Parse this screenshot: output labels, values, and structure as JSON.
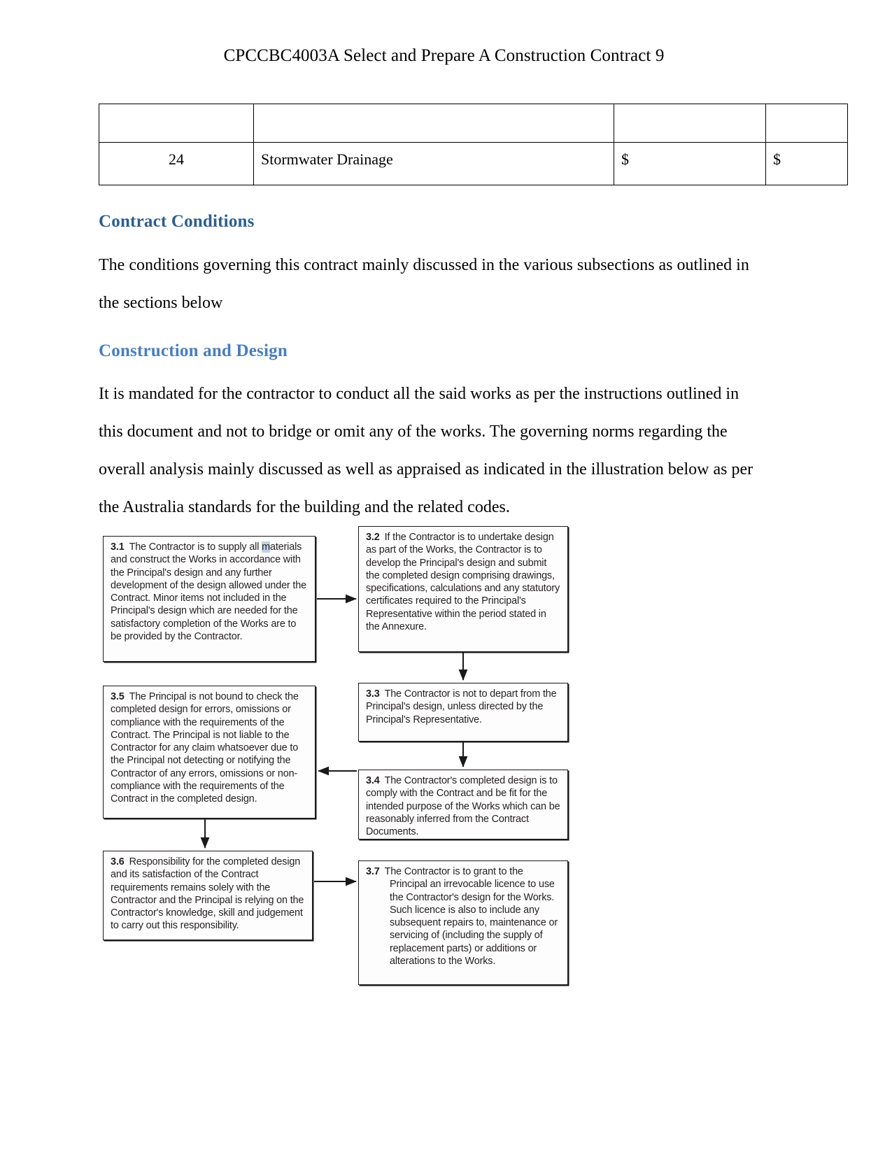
{
  "header": {
    "running_title": "CPCCBC4003A Select and Prepare A Construction Contract 9"
  },
  "table": {
    "rows": [
      {
        "no": "",
        "description": "",
        "rate": "",
        "amount": ""
      },
      {
        "no": "24",
        "description": "Stormwater Drainage",
        "rate": "$",
        "amount": "$"
      }
    ]
  },
  "sections": [
    {
      "heading": "Contract Conditions",
      "paragraph": "The conditions governing this contract mainly discussed in the various subsections as outlined in the sections below"
    },
    {
      "heading": "Construction and Design",
      "paragraph": "It is mandated for the contractor to conduct all the said works as per the instructions outlined  in this document and not to bridge or omit any of  the works. The governing norms regarding the overall analysis mainly discussed as well as appraised as indicated in the illustration below as per the Australia standards for the building and the related codes."
    }
  ],
  "flowchart": {
    "boxes": [
      {
        "id": "3.1",
        "number": "3.1",
        "highlight": "m",
        "text_before_highlight": "The Contractor is to supply all ",
        "text_after_highlight": "aterials and construct the Works in accordance with the Principal's design and any further development of the design allowed under the Contract. Minor items not included in the Principal's design which are needed for the satisfactory completion of the Works are to be provided by the Contractor."
      },
      {
        "id": "3.2",
        "number": "3.2",
        "text": "If the Contractor is to undertake design as part of the Works, the Contractor is to develop the Principal's design and submit the completed design comprising drawings, specifications, calculations and any statutory certificates required to the Principal's Representative within the period stated in the Annexure."
      },
      {
        "id": "3.3",
        "number": "3.3",
        "text": "The Contractor is not to depart from the Principal's design, unless directed by the Principal's Representative."
      },
      {
        "id": "3.4",
        "number": "3.4",
        "text": "The Contractor's completed design is to comply with the Contract and be fit for the intended purpose of the Works which can be reasonably inferred from the Contract Documents."
      },
      {
        "id": "3.5",
        "number": "3.5",
        "text": "The Principal is not bound to check the completed design for errors, omissions or compliance with the requirements of the Contract.  The Principal is not liable to the Contractor for any claim whatsoever due to the Principal not detecting or notifying the Contractor of any errors, omissions or non-compliance with the requirements of the Contract in the completed design."
      },
      {
        "id": "3.6",
        "number": "3.6",
        "text": "Responsibility for the completed design and its satisfaction of the Contract requirements remains solely with the Contractor and the Principal is relying on the Contractor's knowledge, skill and judgement to carry out this responsibility."
      },
      {
        "id": "3.7",
        "number": "3.7",
        "text": "The Contractor is to grant to the Principal an irrevocable licence to use the Contractor's design for the Works. Such licence is also to include any subsequent repairs to, maintenance or servicing of (including the supply of replacement parts) or additions or alterations to the Works."
      }
    ]
  },
  "colors": {
    "heading_dark_blue": "#2E5E8C",
    "heading_light_blue": "#4A7EBB",
    "body_text": "#000000",
    "flow_text": "#231F20",
    "highlight": "#BCD3E6"
  }
}
